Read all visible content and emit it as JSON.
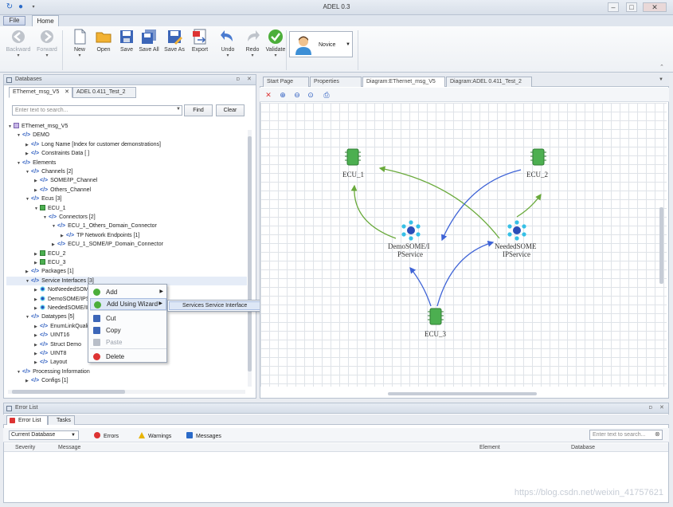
{
  "window": {
    "title": "ADEL 0.3",
    "file_tab": "File",
    "home_tab": "Home",
    "controls": [
      "–",
      "□",
      "✕"
    ]
  },
  "ribbon": {
    "buttons": [
      {
        "label": "Backward",
        "icon": "back-arrow-icon",
        "disabled": true,
        "chevron": true
      },
      {
        "label": "Forward",
        "icon": "forward-arrow-icon",
        "disabled": true,
        "chevron": true
      },
      {
        "label": "New",
        "icon": "new-document-icon",
        "disabled": false,
        "chevron": true
      },
      {
        "label": "Open",
        "icon": "folder-icon",
        "disabled": false,
        "chevron": false
      },
      {
        "label": "Save",
        "icon": "save-icon",
        "disabled": false,
        "chevron": false
      },
      {
        "label": "Save All",
        "icon": "save-all-icon",
        "disabled": false,
        "chevron": false
      },
      {
        "label": "Save As",
        "icon": "save-as-icon",
        "disabled": false,
        "chevron": false
      },
      {
        "label": "Export",
        "icon": "export-icon",
        "disabled": false,
        "chevron": false
      },
      {
        "label": "Undo",
        "icon": "undo-icon",
        "disabled": false,
        "chevron": true
      },
      {
        "label": "Redo",
        "icon": "redo-icon",
        "disabled": false,
        "chevron": true
      },
      {
        "label": "Validate",
        "icon": "validate-check-icon",
        "disabled": false,
        "chevron": true
      }
    ],
    "user": {
      "name": "Novice",
      "icon": "user-avatar-icon"
    }
  },
  "left_pane": {
    "title": "Databases",
    "tabs": [
      "EThernet_msg_V5",
      "ADEL 0.411_Test_2"
    ],
    "search_placeholder": "Enter text to search...",
    "find_label": "Find",
    "clear_label": "Clear",
    "tree": [
      {
        "depth": 0,
        "text": "EThernet_msg_V5",
        "tag": "",
        "kind": "db",
        "open": true
      },
      {
        "depth": 1,
        "text": "DEMO",
        "tag": "</>",
        "kind": "node",
        "open": true
      },
      {
        "depth": 2,
        "text": "Long Name [Index for customer demonstrations]",
        "tag": "</>",
        "kind": "leaf"
      },
      {
        "depth": 2,
        "text": "Constraints Data [ ]",
        "tag": "</>",
        "kind": "node",
        "open": false
      },
      {
        "depth": 1,
        "text": "Elements",
        "tag": "</>",
        "kind": "node",
        "open": true
      },
      {
        "depth": 2,
        "text": "Channels [2]",
        "tag": "</>",
        "kind": "node",
        "open": true
      },
      {
        "depth": 3,
        "text": "SOME/IP_Channel",
        "tag": "</>",
        "kind": "node",
        "open": false
      },
      {
        "depth": 3,
        "text": "Others_Channel",
        "tag": "</>",
        "kind": "node",
        "open": false
      },
      {
        "depth": 2,
        "text": "Ecus [3]",
        "tag": "</>",
        "kind": "node",
        "open": true
      },
      {
        "depth": 3,
        "text": "ECU_1",
        "tag": "",
        "kind": "ecu",
        "open": true
      },
      {
        "depth": 4,
        "text": "Connectors [2]",
        "tag": "</>",
        "kind": "node",
        "open": true
      },
      {
        "depth": 5,
        "text": "ECU_1_Others_Domain_Connector",
        "tag": "</>",
        "kind": "node",
        "open": true
      },
      {
        "depth": 6,
        "text": "TP Network Endpoints [1]",
        "tag": "</>",
        "kind": "node",
        "open": false
      },
      {
        "depth": 5,
        "text": "ECU_1_SOME/IP_Domain_Connector",
        "tag": "</>",
        "kind": "node",
        "open": false
      },
      {
        "depth": 3,
        "text": "ECU_2",
        "tag": "",
        "kind": "ecu",
        "open": false
      },
      {
        "depth": 3,
        "text": "ECU_3",
        "tag": "",
        "kind": "ecu",
        "open": false
      },
      {
        "depth": 2,
        "text": "Packages [1]",
        "tag": "</>",
        "kind": "node",
        "open": false
      },
      {
        "depth": 2,
        "text": "Service Interfaces [3]",
        "tag": "</>",
        "kind": "node",
        "open": true,
        "selected": true
      },
      {
        "depth": 3,
        "text": "NotNeededSOME/IPService",
        "tag": "",
        "kind": "svc",
        "open": false
      },
      {
        "depth": 3,
        "text": "DemoSOME/IPService",
        "tag": "",
        "kind": "svc",
        "open": false
      },
      {
        "depth": 3,
        "text": "NeededSOME/IPService",
        "tag": "",
        "kind": "svc",
        "open": false
      },
      {
        "depth": 2,
        "text": "Datatypes [5]",
        "tag": "</>",
        "kind": "node",
        "open": true
      },
      {
        "depth": 3,
        "text": "EnumLinkQuality",
        "tag": "</>",
        "kind": "node",
        "open": false
      },
      {
        "depth": 3,
        "text": "UINT16",
        "tag": "</>",
        "kind": "node",
        "open": false
      },
      {
        "depth": 3,
        "text": "Struct Demo",
        "tag": "</>",
        "kind": "node",
        "open": false
      },
      {
        "depth": 3,
        "text": "UINT8",
        "tag": "</>",
        "kind": "node",
        "open": false
      },
      {
        "depth": 3,
        "text": "Layout",
        "tag": "</>",
        "kind": "node",
        "open": false
      },
      {
        "depth": 1,
        "text": "Processing Information",
        "tag": "</>",
        "kind": "node",
        "open": true
      },
      {
        "depth": 2,
        "text": "Configs [1]",
        "tag": "</>",
        "kind": "node",
        "open": false
      }
    ]
  },
  "context_menu": {
    "items": [
      {
        "label": "Add",
        "icon": "add-icon",
        "submenu": true,
        "disabled": false
      },
      {
        "label": "Add Using Wizard",
        "icon": "wizard-add-icon",
        "submenu": true,
        "disabled": false,
        "highlight": true
      },
      {
        "label": "Cut",
        "icon": "scissors-icon",
        "submenu": false,
        "disabled": false
      },
      {
        "label": "Copy",
        "icon": "copy-icon",
        "submenu": false,
        "disabled": false
      },
      {
        "label": "Paste",
        "icon": "paste-icon",
        "submenu": false,
        "disabled": true
      },
      {
        "label": "Delete",
        "icon": "delete-icon",
        "submenu": false,
        "disabled": false
      }
    ],
    "submenu_item": "Services Service Interface"
  },
  "diagram": {
    "tabs": [
      "Start Page",
      "Properties",
      "Diagram:EThernet_msg_V5",
      "Diagram:ADEL 0.411_Test_2"
    ],
    "active_tab": 2,
    "toolbar": [
      "delete-icon",
      "zoom-in-icon",
      "zoom-out-icon",
      "zoom-fit-icon",
      "print-icon"
    ],
    "nodes": {
      "ecu1": "ECU_1",
      "ecu2": "ECU_2",
      "ecu3": "ECU_3",
      "svc_demo_l1": "DemoSOME/I",
      "svc_demo_l2": "PService",
      "svc_needed_l1": "NeededSOME",
      "svc_needed_l2": "IPService"
    },
    "colors": {
      "provide": "#6aaa3c",
      "consume": "#3e63d6"
    }
  },
  "error_pane": {
    "title": "Error List",
    "tabs": [
      "Error List",
      "Tasks"
    ],
    "scope": "Current Database",
    "filters": [
      {
        "label": "Errors",
        "icon": "error-icon"
      },
      {
        "label": "Warnings",
        "icon": "warning-icon"
      },
      {
        "label": "Messages",
        "icon": "message-icon"
      }
    ],
    "search_placeholder": "Enter text to search...",
    "columns": [
      "Severity",
      "Message",
      "Element",
      "Database"
    ]
  },
  "watermark": "https://blog.csdn.net/weixin_41757621"
}
